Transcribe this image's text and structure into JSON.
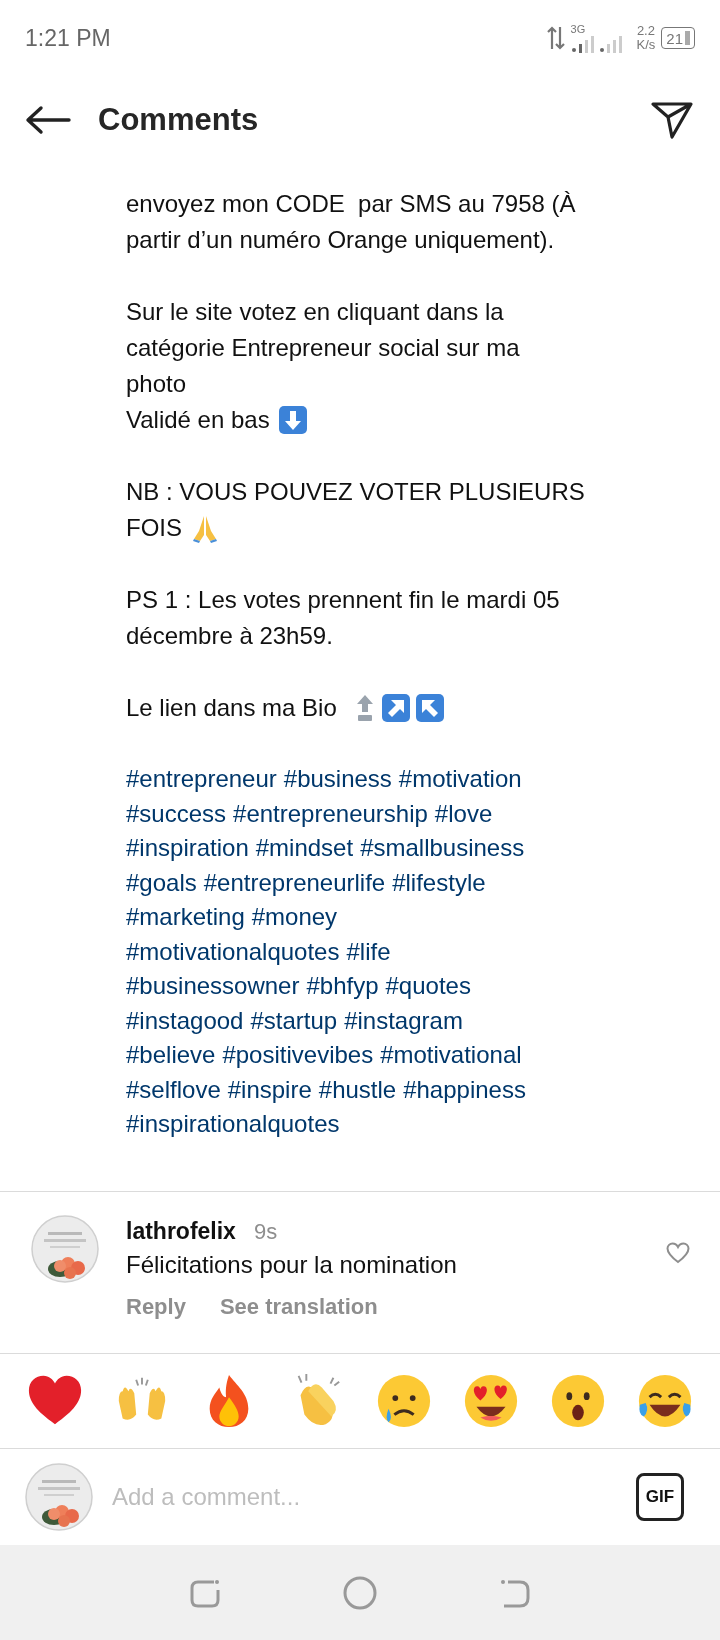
{
  "status_bar": {
    "time": "1:21 PM",
    "network": "3G",
    "speed_value": "2.2",
    "speed_unit": "K/s",
    "battery": "21"
  },
  "header": {
    "title": "Comments"
  },
  "caption": {
    "paragraphs": [
      {
        "lines": [
          {
            "text": "envoyez mon CODE  par SMS au 7958 (À",
            "kind": "plain"
          },
          {
            "text": "partir d’un numéro Orange uniquement).",
            "kind": "plain"
          }
        ]
      },
      {
        "lines": [
          {
            "text": "Sur le site votez en cliquant dans la",
            "kind": "plain"
          },
          {
            "text": "catégorie Entrepreneur social sur ma",
            "kind": "plain"
          },
          {
            "text": "photo",
            "kind": "plain"
          },
          {
            "text": "Validé en bas",
            "kind": "down"
          }
        ]
      },
      {
        "lines": [
          {
            "text": "NB : VOUS POUVEZ VOTER PLUSIEURS",
            "kind": "plain"
          },
          {
            "text": "FOIS",
            "kind": "pray"
          }
        ]
      },
      {
        "lines": [
          {
            "text": "PS 1 : Les votes prennent fin le mardi 05",
            "kind": "plain"
          },
          {
            "text": "décembre à 23h59.",
            "kind": "plain"
          }
        ]
      },
      {
        "lines": [
          {
            "text": "Le lien dans ma Bio",
            "kind": "arrows"
          }
        ]
      }
    ],
    "hashtag_lines": [
      [
        "#entrepreneur",
        "#business",
        "#motivation"
      ],
      [
        "#success",
        "#entrepreneurship",
        "#love"
      ],
      [
        "#inspiration",
        "#mindset",
        "#smallbusiness"
      ],
      [
        "#goals",
        "#entrepreneurlife",
        "#lifestyle"
      ],
      [
        "#marketing",
        "#money"
      ],
      [
        "#motivationalquotes",
        "#life"
      ],
      [
        "#businessowner",
        "#bhfyp",
        "#quotes"
      ],
      [
        "#instagood",
        "#startup",
        "#instagram"
      ],
      [
        "#believe",
        "#positivevibes",
        "#motivational"
      ],
      [
        "#selflove",
        "#inspire",
        "#hustle",
        "#happiness"
      ],
      [
        "#inspirationalquotes"
      ]
    ]
  },
  "comments": [
    {
      "username": "lathrofelix",
      "time": "9s",
      "text": "Félicitations pour la nomination",
      "liked": false,
      "actions": [
        "Reply",
        "See translation"
      ]
    }
  ],
  "reactions": [
    {
      "kind": "heart"
    },
    {
      "kind": "raised-hands"
    },
    {
      "kind": "fire"
    },
    {
      "kind": "clap"
    },
    {
      "kind": "sad"
    },
    {
      "kind": "heart-eyes"
    },
    {
      "kind": "wow"
    },
    {
      "kind": "laugh"
    }
  ],
  "composer": {
    "placeholder": "Add a comment...",
    "gif_label": "GIF"
  }
}
